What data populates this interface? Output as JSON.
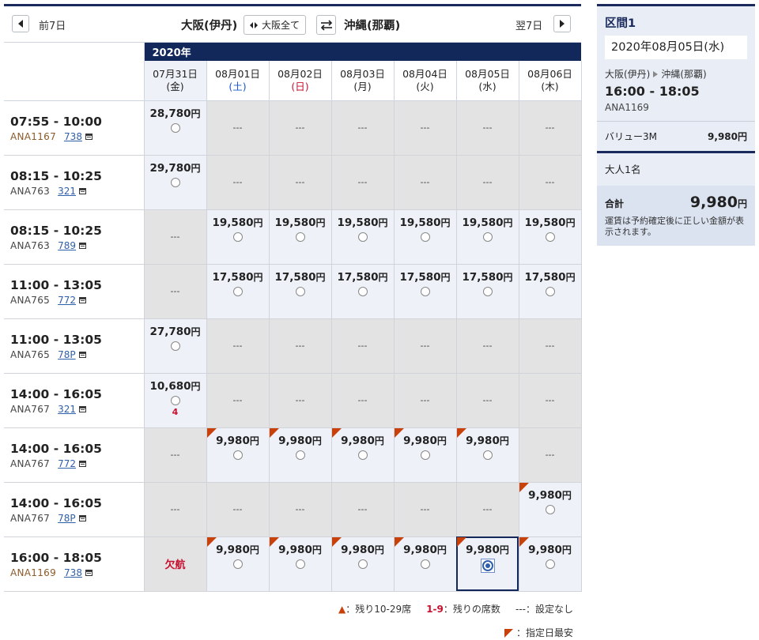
{
  "nav": {
    "prev_label": "前7日",
    "next_label": "翌7日",
    "origin": "大阪(伊丹)",
    "airport_toggle": "大阪全て",
    "destination": "沖縄(那覇)"
  },
  "grid": {
    "year": "2020年",
    "dates": [
      {
        "date": "07月31日",
        "dow": "(金)",
        "dow_type": "weekday"
      },
      {
        "date": "08月01日",
        "dow": "(土)",
        "dow_type": "sat"
      },
      {
        "date": "08月02日",
        "dow": "(日)",
        "dow_type": "sun"
      },
      {
        "date": "08月03日",
        "dow": "(月)",
        "dow_type": "weekday"
      },
      {
        "date": "08月04日",
        "dow": "(火)",
        "dow_type": "weekday"
      },
      {
        "date": "08月05日",
        "dow": "(水)",
        "dow_type": "weekday"
      },
      {
        "date": "08月06日",
        "dow": "(木)",
        "dow_type": "weekday"
      }
    ],
    "flights": [
      {
        "time": "07:55 - 10:00",
        "flight": "ANA1167",
        "equipment": "738",
        "brown": true,
        "cells": [
          {
            "price": "28,780",
            "unit": "円"
          },
          {
            "na": "---"
          },
          {
            "na": "---"
          },
          {
            "na": "---"
          },
          {
            "na": "---"
          },
          {
            "na": "---"
          },
          {
            "na": "---"
          }
        ]
      },
      {
        "time": "08:15 - 10:25",
        "flight": "ANA763",
        "equipment": "321",
        "brown": false,
        "cells": [
          {
            "price": "29,780",
            "unit": "円"
          },
          {
            "na": "---"
          },
          {
            "na": "---"
          },
          {
            "na": "---"
          },
          {
            "na": "---"
          },
          {
            "na": "---"
          },
          {
            "na": "---"
          }
        ]
      },
      {
        "time": "08:15 - 10:25",
        "flight": "ANA763",
        "equipment": "789",
        "brown": false,
        "cells": [
          {
            "na": "---"
          },
          {
            "price": "19,580",
            "unit": "円"
          },
          {
            "price": "19,580",
            "unit": "円"
          },
          {
            "price": "19,580",
            "unit": "円"
          },
          {
            "price": "19,580",
            "unit": "円"
          },
          {
            "price": "19,580",
            "unit": "円"
          },
          {
            "price": "19,580",
            "unit": "円"
          }
        ]
      },
      {
        "time": "11:00 - 13:05",
        "flight": "ANA765",
        "equipment": "772",
        "brown": false,
        "cells": [
          {
            "na": "---"
          },
          {
            "price": "17,580",
            "unit": "円"
          },
          {
            "price": "17,580",
            "unit": "円"
          },
          {
            "price": "17,580",
            "unit": "円"
          },
          {
            "price": "17,580",
            "unit": "円"
          },
          {
            "price": "17,580",
            "unit": "円"
          },
          {
            "price": "17,580",
            "unit": "円"
          }
        ]
      },
      {
        "time": "11:00 - 13:05",
        "flight": "ANA765",
        "equipment": "78P",
        "brown": false,
        "cells": [
          {
            "price": "27,780",
            "unit": "円"
          },
          {
            "na": "---"
          },
          {
            "na": "---"
          },
          {
            "na": "---"
          },
          {
            "na": "---"
          },
          {
            "na": "---"
          },
          {
            "na": "---"
          }
        ]
      },
      {
        "time": "14:00 - 16:05",
        "flight": "ANA767",
        "equipment": "321",
        "brown": false,
        "cells": [
          {
            "price": "10,680",
            "unit": "円",
            "seats": "4"
          },
          {
            "na": "---"
          },
          {
            "na": "---"
          },
          {
            "na": "---"
          },
          {
            "na": "---"
          },
          {
            "na": "---"
          },
          {
            "na": "---"
          }
        ]
      },
      {
        "time": "14:00 - 16:05",
        "flight": "ANA767",
        "equipment": "772",
        "brown": false,
        "cells": [
          {
            "na": "---"
          },
          {
            "price": "9,980",
            "unit": "円",
            "flag": true
          },
          {
            "price": "9,980",
            "unit": "円",
            "flag": true
          },
          {
            "price": "9,980",
            "unit": "円",
            "flag": true
          },
          {
            "price": "9,980",
            "unit": "円",
            "flag": true
          },
          {
            "price": "9,980",
            "unit": "円",
            "flag": true
          },
          {
            "na": "---"
          }
        ]
      },
      {
        "time": "14:00 - 16:05",
        "flight": "ANA767",
        "equipment": "78P",
        "brown": false,
        "cells": [
          {
            "na": "---"
          },
          {
            "na": "---"
          },
          {
            "na": "---"
          },
          {
            "na": "---"
          },
          {
            "na": "---"
          },
          {
            "na": "---"
          },
          {
            "price": "9,980",
            "unit": "円",
            "flag": true
          }
        ]
      },
      {
        "time": "16:00 - 18:05",
        "flight": "ANA1169",
        "equipment": "738",
        "brown": true,
        "cells": [
          {
            "cancel": "欠航"
          },
          {
            "price": "9,980",
            "unit": "円",
            "flag": true
          },
          {
            "price": "9,980",
            "unit": "円",
            "flag": true
          },
          {
            "price": "9,980",
            "unit": "円",
            "flag": true
          },
          {
            "price": "9,980",
            "unit": "円",
            "flag": true
          },
          {
            "price": "9,980",
            "unit": "円",
            "flag": true,
            "selected": true
          },
          {
            "price": "9,980",
            "unit": "円",
            "flag": true
          }
        ]
      }
    ]
  },
  "legend": {
    "tri_symbol": "▲",
    "tri_text": "：残り10-29席",
    "seats_symbol": "1-9",
    "seats_text": "：残りの席数",
    "na_symbol": "---",
    "na_text": "：設定なし",
    "cheapest_text": "：指定日最安"
  },
  "sidebar": {
    "title": "区間1",
    "date": "2020年08月05日(水)",
    "from": "大阪(伊丹)",
    "to": "沖縄(那覇)",
    "time": "16:00 - 18:05",
    "flight": "ANA1169",
    "fare_name": "バリュー3M",
    "fare_amount": "9,980円",
    "passengers": "大人1名",
    "total_label": "合計",
    "total_amount": "9,980",
    "total_unit": "円",
    "note": "運賃は予約確定後に正しい金額が表示されます。"
  },
  "colors": {
    "navy": "#12285a",
    "flag": "#c8400a",
    "sunday": "#c8102e",
    "saturday": "#1a56c8"
  }
}
